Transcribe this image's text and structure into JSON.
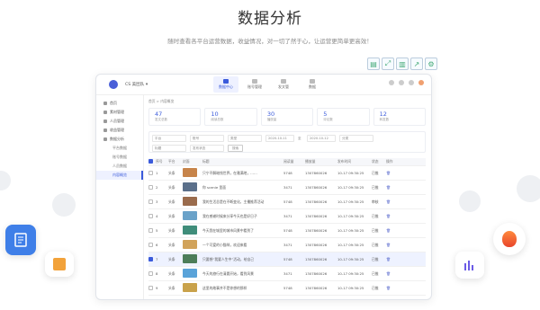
{
  "hero": {
    "title": "数据分析",
    "subtitle": "随时查看各平台运营数据，收益情况，对一切了然于心，让运营更简单更高效！"
  },
  "toolbar": {
    "icons": [
      "doc-icon",
      "expand-icon",
      "delete-icon",
      "share-icon",
      "settings-icon"
    ]
  },
  "app": {
    "org": "CS 美团队 ▾",
    "nav": [
      {
        "label": "数据中心",
        "active": true
      },
      {
        "label": "账号管理",
        "active": false
      },
      {
        "label": "发文管",
        "active": false
      },
      {
        "label": "数据",
        "active": false
      }
    ],
    "sidebar": [
      {
        "label": "首页",
        "sub": false,
        "active": false
      },
      {
        "label": "素材管理",
        "sub": false,
        "active": false
      },
      {
        "label": "人员管理",
        "sub": false,
        "active": false
      },
      {
        "label": "收益管理",
        "sub": false,
        "active": false
      },
      {
        "label": "数据分析",
        "sub": false,
        "active": false
      },
      {
        "label": "平台数据",
        "sub": true,
        "active": false
      },
      {
        "label": "账号数据",
        "sub": true,
        "active": false
      },
      {
        "label": "人员数据",
        "sub": true,
        "active": false
      },
      {
        "label": "内容概览",
        "sub": true,
        "active": true
      }
    ],
    "breadcrumb": "首页 > 内容概览",
    "stats": [
      {
        "value": "47",
        "label": "发文总数"
      },
      {
        "value": "10",
        "label": "阅读总数"
      },
      {
        "value": "30",
        "label": "播放量"
      },
      {
        "value": "5",
        "label": "评论数"
      },
      {
        "value": "12",
        "label": "转发数"
      }
    ],
    "filters": {
      "row1": [
        "平台",
        "账号",
        "类型",
        "2020-10-11",
        "至",
        "2020-10-12",
        "分类"
      ],
      "row2": [
        "标题",
        "发布状态",
        "搜索"
      ]
    },
    "table": {
      "headers": [
        "序号",
        "平台",
        "封面",
        "标题",
        "阅读量",
        "播放量",
        "发布时间",
        "状态",
        "操作"
      ],
      "rows": [
        {
          "n": "1",
          "platform": "头条",
          "title": "只宁不解暗钱世界，在雅满地，……",
          "read": "5748",
          "play": "1307860026",
          "time": "10-17 09:30:25",
          "status": "已推",
          "sel": false,
          "thumb": "#c7844a"
        },
        {
          "n": "2",
          "platform": "头条",
          "title": "你 scenie 里面",
          "read": "3471",
          "play": "1307860026",
          "time": "10-17 09:30:25",
          "status": "已推",
          "sel": false,
          "thumb": "#5a6f8a"
        },
        {
          "n": "3",
          "platform": "头条",
          "title": "我的生活总是在不断变化，主播推荐活动",
          "read": "5748",
          "play": "1307860026",
          "time": "10-17 09:30:25",
          "status": "审核",
          "sel": false,
          "thumb": "#9a6b4c"
        },
        {
          "n": "4",
          "platform": "头条",
          "title": "我在感谢时候来分享今天也是好日子",
          "read": "3471",
          "play": "1307860026",
          "time": "10-17 09:30:25",
          "status": "已推",
          "sel": false,
          "thumb": "#6aa2c9"
        },
        {
          "n": "5",
          "platform": "头条",
          "title": "今天我在城里的城市风景中看到了",
          "read": "5748",
          "play": "1307860026",
          "time": "10-17 09:30:25",
          "status": "已推",
          "sel": false,
          "thumb": "#3f8d7a"
        },
        {
          "n": "6",
          "platform": "头条",
          "title": "一个可爱的小猫咪，欢迎来看",
          "read": "3471",
          "play": "1307860026",
          "time": "10-17 09:30:25",
          "status": "已推",
          "sel": false,
          "thumb": "#d1a35b"
        },
        {
          "n": "7",
          "platform": "头条",
          "title": "只要想“我要人生中”活动，给自己",
          "read": "5748",
          "play": "1307860026",
          "time": "10-17 09:30:25",
          "status": "已推",
          "sel": true,
          "thumb": "#4c7d59"
        },
        {
          "n": "8",
          "platform": "头条",
          "title": "今天的旅行在清晨开始，看到风景",
          "read": "3471",
          "play": "1307860026",
          "time": "10-17 09:30:25",
          "status": "已推",
          "sel": false,
          "thumb": "#5aa3d9"
        },
        {
          "n": "9",
          "platform": "头条",
          "title": "这里的故事并不是你想的那样",
          "read": "5748",
          "play": "1307860026",
          "time": "10-17 09:30:25",
          "status": "已推",
          "sel": false,
          "thumb": "#c9a24b"
        }
      ]
    }
  }
}
